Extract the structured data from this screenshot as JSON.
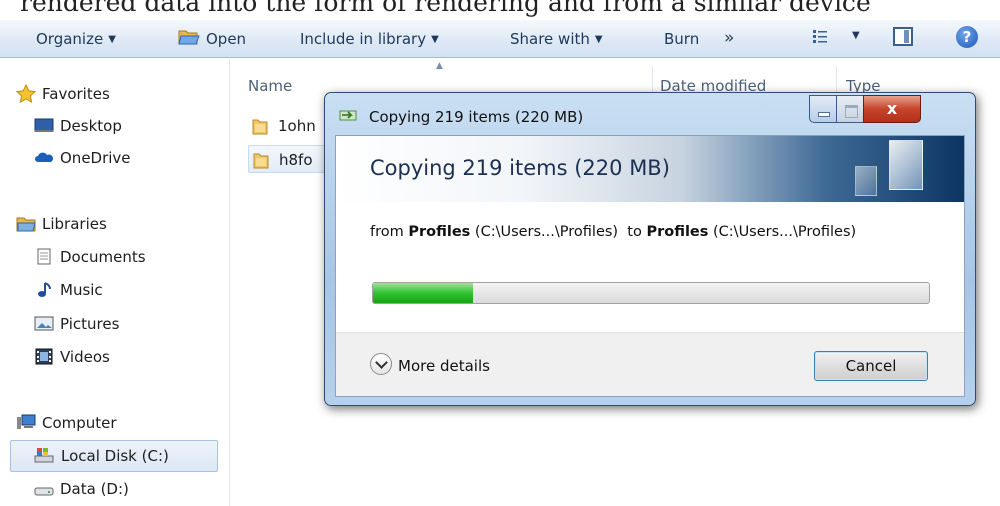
{
  "top_text": "rendered data into the form of rendering and from a similar device",
  "toolbar": {
    "organize": "Organize",
    "open": "Open",
    "include_in_library": "Include in library",
    "share_with": "Share with",
    "burn": "Burn",
    "more": "»"
  },
  "nav": {
    "favorites": "Favorites",
    "desktop": "Desktop",
    "onedrive": "OneDrive",
    "libraries": "Libraries",
    "documents": "Documents",
    "music": "Music",
    "pictures": "Pictures",
    "videos": "Videos",
    "computer": "Computer",
    "local_disk": "Local Disk (C:)",
    "data_drive": "Data (D:)"
  },
  "list": {
    "col_name": "Name",
    "col_date": "Date modified",
    "col_type": "Type",
    "rows": [
      "1ohn",
      "h8fo"
    ]
  },
  "dialog": {
    "title": "Copying 219 items (220 MB)",
    "header": "Copying 219 items (220 MB)",
    "from_prefix": "from ",
    "source_name": "Profiles",
    "source_path": " (C:\\Users...\\Profiles)",
    "to_prefix": "  to ",
    "dest_name": "Profiles",
    "dest_path": " (C:\\Users...\\Profiles)",
    "progress_percent": 18,
    "close_symbol": "x",
    "more_details": "More details",
    "cancel": "Cancel"
  },
  "colors": {
    "accent": "#1e395b",
    "progress_fill": "#2fc42f",
    "close_button": "#c7432a"
  }
}
